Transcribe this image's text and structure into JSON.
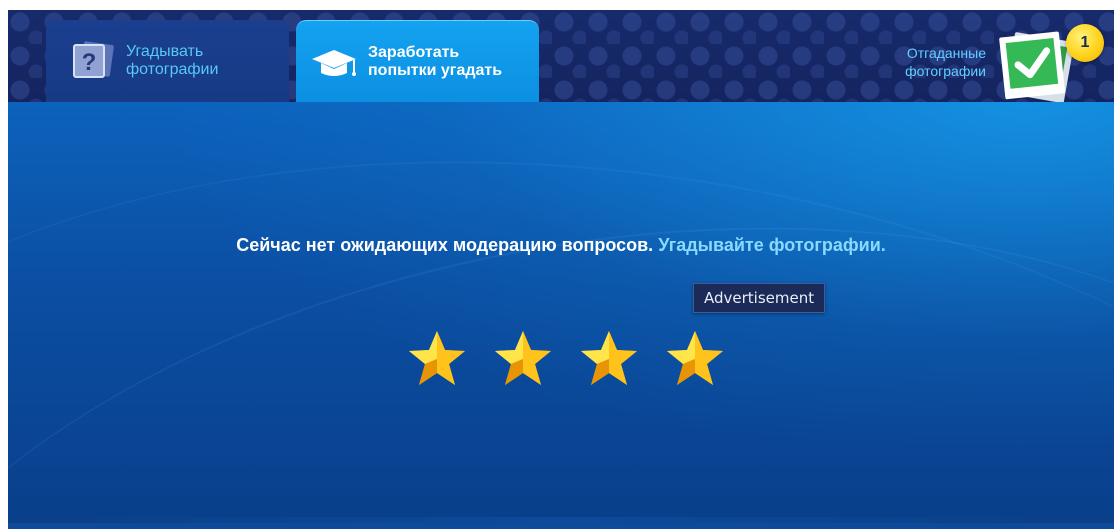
{
  "tabs": [
    {
      "label": "Угадывать\nфотографии",
      "active": false,
      "icon": "question-photo-icon"
    },
    {
      "label": "Заработать\nпопытки угадать",
      "active": true,
      "icon": "graduation-cap-icon"
    }
  ],
  "solved": {
    "label": "Отгаданные\nфотографии",
    "icon": "checkmark-photo-icon",
    "count": "1"
  },
  "main": {
    "message_text": "Сейчас нет ожидающих модерацию вопросов.",
    "message_link": "Угадывайте фотографии.",
    "tooltip": "Advertisement",
    "stars": [
      {
        "icon": "star-icon"
      },
      {
        "icon": "star-icon"
      },
      {
        "icon": "star-icon"
      },
      {
        "icon": "star-icon"
      }
    ]
  },
  "colors": {
    "topbar_bg": "#162866",
    "tab_inactive": "#183c88",
    "tab_active": "#11a0ee",
    "inactive_text": "#58c8f5",
    "link": "#8ad9ff",
    "badge": "#ffd21b",
    "main_bg": "#0b4ea2",
    "star": "#ffcc16"
  }
}
